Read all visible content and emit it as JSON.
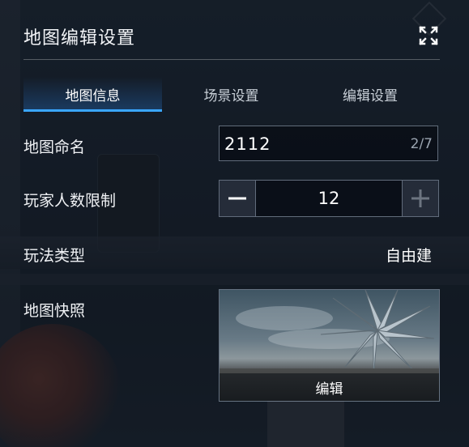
{
  "header": {
    "title": "地图编辑设置",
    "close_icon": "close-icon"
  },
  "tabs": [
    {
      "label": "地图信息",
      "active": true
    },
    {
      "label": "场景设置",
      "active": false
    },
    {
      "label": "编辑设置",
      "active": false
    }
  ],
  "fields": {
    "name": {
      "label": "地图命名",
      "value": "2112",
      "counter": "2/7"
    },
    "player_limit": {
      "label": "玩家人数限制",
      "value": "12",
      "minus_icon": "minus-icon",
      "plus_icon": "plus-icon"
    },
    "mode": {
      "label": "玩法类型",
      "value": "自由建"
    },
    "snapshot": {
      "label": "地图快照",
      "edit_label": "编辑"
    }
  },
  "colors": {
    "accent": "#3aa6ff",
    "border": "#aab9cd",
    "panel": "#0e141e"
  }
}
